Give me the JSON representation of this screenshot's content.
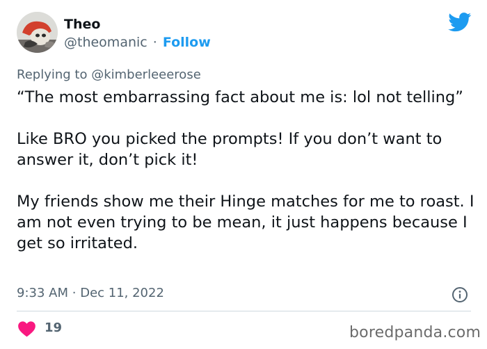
{
  "author": {
    "display_name": "Theo",
    "handle": "@theomanic",
    "separator": "·",
    "follow_label": "Follow"
  },
  "reply": {
    "prefix": "Replying to",
    "mention": "@kimberleeerose"
  },
  "tweet": {
    "paragraphs": [
      "“The most embarrassing fact about me is: lol not telling”",
      "Like BRO you picked the prompts! If you don’t want to answer it, don’t pick it!",
      "My friends show me their Hinge matches for me to roast. I am not even trying to be mean, it just happens because I get so irritated."
    ],
    "time": "9:33 AM",
    "date_separator": "·",
    "date": "Dec 11, 2022"
  },
  "engagement": {
    "likes": "19"
  },
  "watermark": "boredpanda.com",
  "colors": {
    "link": "#1d9bf0",
    "like": "#f91880",
    "muted": "#536471",
    "text": "#0f1419"
  },
  "icons": {
    "brand": "twitter-bird-icon",
    "info": "info-icon",
    "like": "heart-icon"
  }
}
